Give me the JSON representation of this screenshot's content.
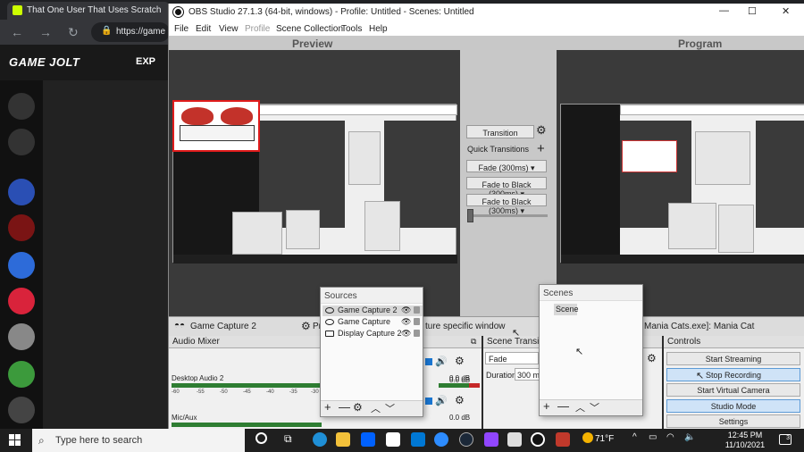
{
  "browser": {
    "tab_title": "That One User That Uses Scratch",
    "url": "https://game",
    "site_logo": "GAME JOLT",
    "site_nav": "EXP"
  },
  "obs": {
    "title": "OBS Studio 27.1.3 (64-bit, windows) - Profile: Untitled - Scenes: Untitled",
    "menu": [
      "File",
      "Edit",
      "View",
      "Profile",
      "Scene Collection",
      "Tools",
      "Help"
    ],
    "preview_label": "Preview",
    "program_label": "Program",
    "transition": {
      "button": "Transition",
      "quick_label": "Quick Transitions",
      "quick_items": [
        "Fade (300ms)",
        "Fade to Black (300ms)",
        "Fade to Black (300ms)"
      ]
    },
    "source_toolbar": {
      "source_name": "Game Capture 2",
      "properties_prefix": "Pr",
      "mode_text": "ture specific window",
      "window_text": "Mania Cats.exe]: Mania Cat"
    },
    "audio_mixer": {
      "title": "Audio Mixer",
      "tracks": [
        {
          "name": "Desktop Audio 2",
          "db": "0.0 dB"
        },
        {
          "name": "Mic/Aux",
          "db": "0.0 dB"
        }
      ],
      "second_db": "0.0 dB",
      "scale": [
        "-60",
        "-55",
        "-50",
        "-45",
        "-40",
        "-35",
        "-30",
        "-25",
        "-20",
        "-15",
        "-10",
        "-5",
        "0"
      ]
    },
    "scene_transitions": {
      "title": "Scene Transition",
      "value": "Fade",
      "duration_label": "Duration",
      "duration_value": "300 ms"
    },
    "controls": {
      "title": "Controls",
      "buttons": [
        "Start Streaming",
        "Stop Recording",
        "Start Virtual Camera",
        "Studio Mode",
        "Settings"
      ]
    },
    "sources_panel": {
      "title": "Sources",
      "items": [
        "Game Capture 2",
        "Game Capture",
        "Display Capture 2"
      ]
    },
    "scenes_panel": {
      "title": "Scenes",
      "items": [
        "Scene"
      ]
    }
  },
  "taskbar": {
    "search_placeholder": "Type here to search",
    "weather": "71°F",
    "time": "12:45 PM",
    "date": "11/10/2021",
    "notifications": "3"
  },
  "colors": {
    "obs_dark": "#2b2b2b",
    "gamejolt_accent": "#ccff00",
    "selection_red": "#e01b1b",
    "control_highlight": "#cfe3f7"
  }
}
